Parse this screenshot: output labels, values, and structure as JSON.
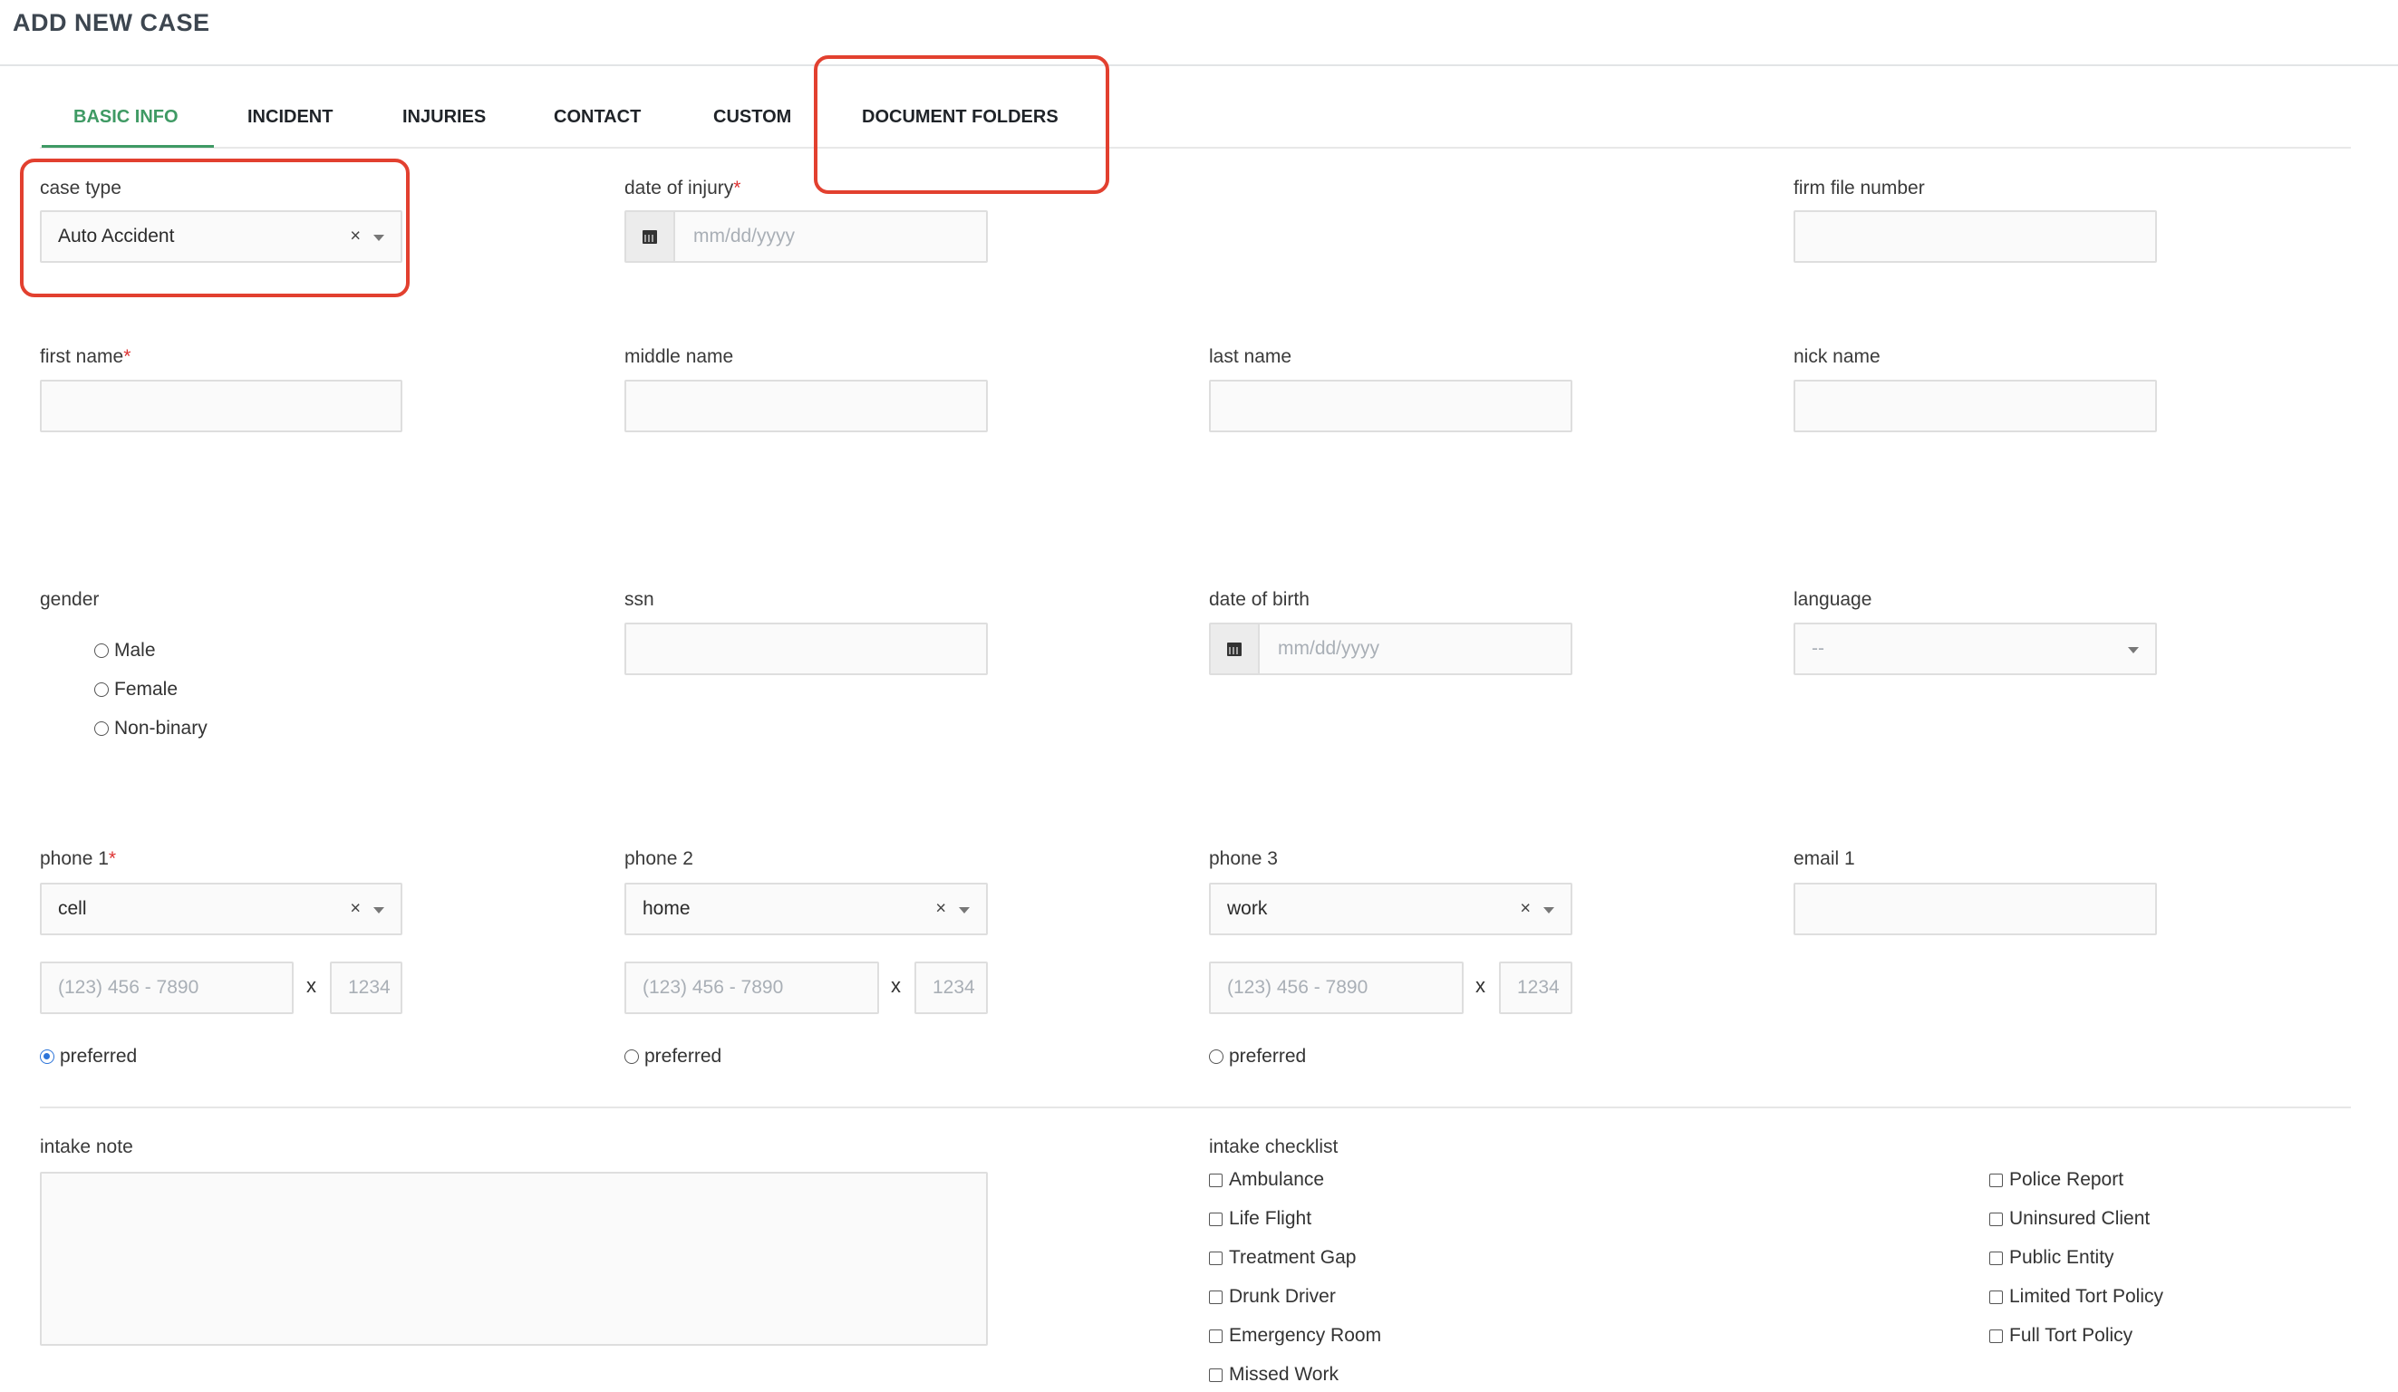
{
  "header": {
    "title": "ADD NEW CASE"
  },
  "tabs": [
    {
      "label": "BASIC INFO",
      "active": true
    },
    {
      "label": "INCIDENT"
    },
    {
      "label": "INJURIES"
    },
    {
      "label": "CONTACT"
    },
    {
      "label": "CUSTOM"
    },
    {
      "label": "DOCUMENT FOLDERS"
    }
  ],
  "case_type": {
    "label": "case type",
    "value": "Auto Accident",
    "clear": "×"
  },
  "date_of_injury": {
    "label": "date of injury",
    "required": "*",
    "placeholder": "mm/dd/yyyy"
  },
  "firm_file_number": {
    "label": "firm file number"
  },
  "first_name": {
    "label": "first name",
    "required": "*"
  },
  "middle_name": {
    "label": "middle name"
  },
  "last_name": {
    "label": "last name"
  },
  "nick_name": {
    "label": "nick name"
  },
  "gender": {
    "label": "gender",
    "options": [
      "Male",
      "Female",
      "Non-binary"
    ]
  },
  "ssn": {
    "label": "ssn"
  },
  "date_of_birth": {
    "label": "date of birth",
    "placeholder": "mm/dd/yyyy"
  },
  "language": {
    "label": "language",
    "value": "--"
  },
  "phones": [
    {
      "label": "phone 1",
      "required": "*",
      "type": "cell",
      "clear": "×",
      "number_placeholder": "(123) 456 - 7890",
      "ext_sep": "x",
      "ext_placeholder": "1234",
      "preferred_label": "preferred",
      "preferred": true
    },
    {
      "label": "phone 2",
      "type": "home",
      "clear": "×",
      "number_placeholder": "(123) 456 - 7890",
      "ext_sep": "x",
      "ext_placeholder": "1234",
      "preferred_label": "preferred",
      "preferred": false
    },
    {
      "label": "phone 3",
      "type": "work",
      "clear": "×",
      "number_placeholder": "(123) 456 - 7890",
      "ext_sep": "x",
      "ext_placeholder": "1234",
      "preferred_label": "preferred",
      "preferred": false
    }
  ],
  "email1": {
    "label": "email 1"
  },
  "intake_note": {
    "label": "intake note"
  },
  "intake_checklist": {
    "label": "intake checklist",
    "left": [
      "Ambulance",
      "Life Flight",
      "Treatment Gap",
      "Drunk Driver",
      "Emergency Room",
      "Missed Work"
    ],
    "right": [
      "Police Report",
      "Uninsured Client",
      "Public Entity",
      "Limited Tort Policy",
      "Full Tort Policy"
    ]
  },
  "colors": {
    "accent": "#3f9a64",
    "highlight": "#e2402f",
    "required": "#dd3333",
    "radio_checked": "#2c74d9"
  }
}
